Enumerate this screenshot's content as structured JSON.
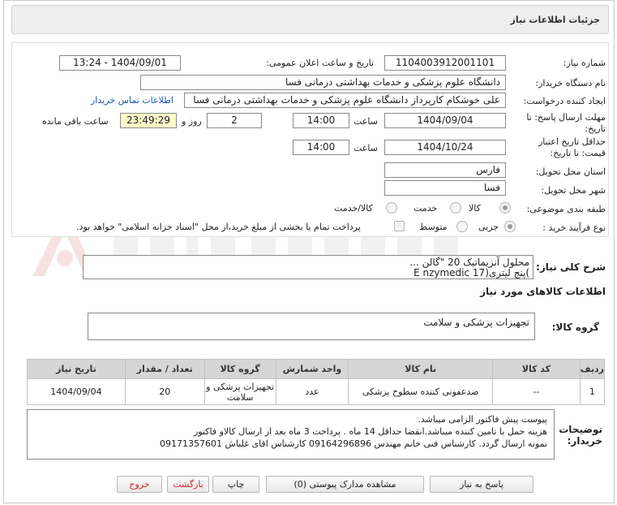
{
  "header": {
    "title": "جزئیات اطلاعات نیاز"
  },
  "form": {
    "need_number_label": "شماره نیاز:",
    "need_number": "1104003912001101",
    "announce_label": "تاریخ و ساعت اعلان عمومی:",
    "announce_value": "1404/09/01 - 13:24",
    "buyer_org_label": "نام دستگاه خریدار:",
    "buyer_org": "دانشگاه علوم پزشکی و خدمات بهداشتی درمانی فسا",
    "creator_label": "ایجاد کننده درخواست:",
    "creator": "علی خوشکام کارپرداز دانشگاه علوم پزشکی و خدمات بهداشتی درمانی فسا",
    "contact_link": "اطلاعات تماس خریدار",
    "deadline_label_1": "مهلت ارسال پاسخ: تا",
    "deadline_label_2": "تاریخ:",
    "deadline_date": "1404/09/04",
    "time_label": "ساعت",
    "deadline_time": "14:00",
    "days_value": "2",
    "days_label": "روز و",
    "remaining_time": "23:49:29",
    "remaining_label": "ساعت باقی مانده",
    "validity_label_1": "حداقل تاریخ اعتبار",
    "validity_label_2": "قیمت: تا تاریخ:",
    "validity_date": "1404/10/24",
    "validity_time_label": "ساعت",
    "validity_time": "14:00",
    "province_label": "استان محل تحویل:",
    "province": "فارس",
    "city_label": "شهر محل تحویل:",
    "city": "فسا",
    "category_label": "طبقه بندی موضوعی:",
    "category_options": [
      "کالا",
      "خدمت",
      "کالا/خدمت"
    ],
    "category_selected": "کالا",
    "process_label": "نوع فرآیند خرید :",
    "process_options": [
      "جزیی",
      "متوسط"
    ],
    "process_selected": "جزیی",
    "treasury_note": "پرداخت تمام یا بخشی از مبلغ خرید،از محل \"اسناد خزانه اسلامی\" خواهد بود."
  },
  "summary": {
    "label": "شرح کلی نیاز:",
    "line1": "محلول آنزیماتیک   20  \"گالن ...",
    "line2": ")پنج لیتری(17 E nzymedic"
  },
  "goods": {
    "section_title": "اطلاعات کالاهای مورد نیاز",
    "group_label": "گروه کالا:",
    "group_value": "تجهیزات پزشکی و سلامت"
  },
  "table": {
    "headers": [
      "ردیف",
      "کد کالا",
      "نام کالا",
      "واحد شمارش",
      "گروه کالا",
      "تعداد / مقدار",
      "تاریخ نیاز"
    ],
    "rows": [
      [
        "1",
        "--",
        "ضدعفونی کننده سطوح پزشکی",
        "عدد",
        "تجهیزات پزشکی و سلامت",
        "20",
        "1404/09/04"
      ]
    ]
  },
  "buyer_notes": {
    "label_1": "توضیحات",
    "label_2": "خریدار:",
    "line1": "پیوست پیش فاکتور الزامی میباشد.",
    "line2": "هزینه حمل با تامین کننده میباشد.انقضا    حداقل 14 ماه . پرداخت 3 ماه بعد از ارسال کالاو فاکتور",
    "line3": "نمونه ارسال گردد.  کارشناس فنی خانم مهندس 09164296896   کارشناس  اقای غلباش 09171357601"
  },
  "buttons": {
    "reply": "پاسخ به نیاز",
    "attachments": "مشاهده مدارک پیوستی (0)",
    "print": "چاپ",
    "back": "بازگشت",
    "exit": "خروج"
  },
  "colors": {
    "link": "#1a56b0",
    "table_header": "#d6d6d6",
    "timer_bg": "#fdf7c9",
    "danger_text": "#c62828"
  },
  "icons": {
    "watermark": "ariatender-logo"
  }
}
